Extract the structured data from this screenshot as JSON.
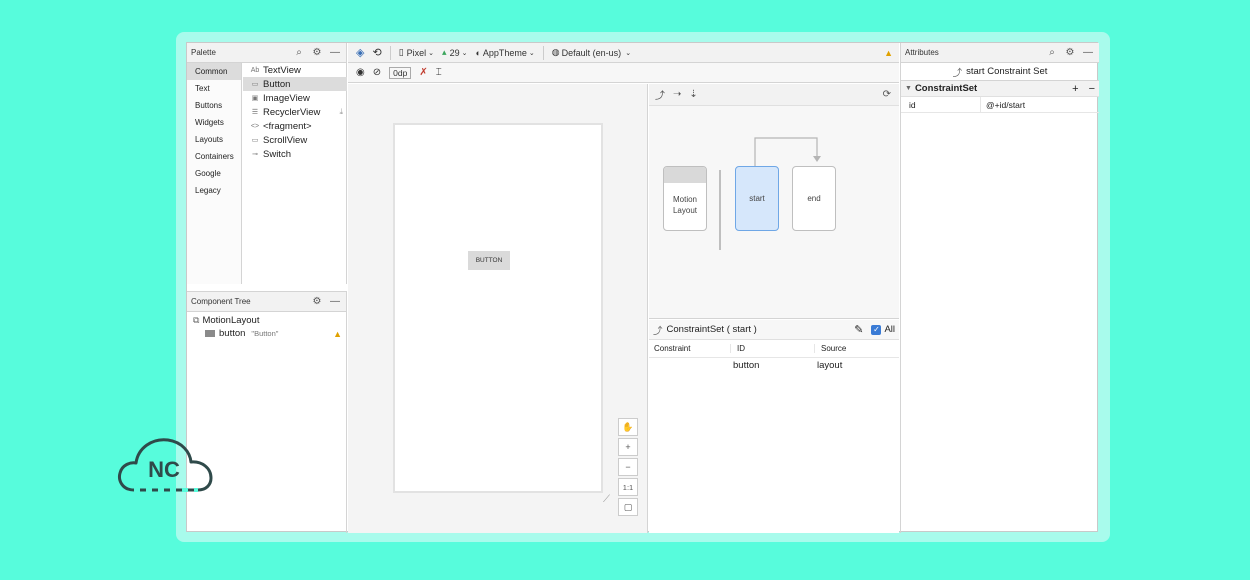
{
  "palette": {
    "title": "Palette",
    "categories": [
      "Common",
      "Text",
      "Buttons",
      "Widgets",
      "Layouts",
      "Containers",
      "Google",
      "Legacy"
    ],
    "widgets": [
      {
        "icon": "Ab",
        "label": "TextView"
      },
      {
        "icon": "▭",
        "label": "Button"
      },
      {
        "icon": "▣",
        "label": "ImageView"
      },
      {
        "icon": "☰",
        "label": "RecyclerView"
      },
      {
        "icon": "<>",
        "label": "<fragment>"
      },
      {
        "icon": "▭",
        "label": "ScrollView"
      },
      {
        "icon": "⊸",
        "label": "Switch"
      }
    ]
  },
  "tree": {
    "title": "Component Tree",
    "root": "MotionLayout",
    "child": "button",
    "child_text": "\"Button\""
  },
  "toolbar": {
    "device": "Pixel",
    "api": "29",
    "theme": "AppTheme",
    "locale": "Default (en-us)",
    "margin": "0dp"
  },
  "canvas": {
    "button_label": "BUTTON",
    "zoom_ratio": "1:1"
  },
  "motion": {
    "states": {
      "layout": "Motion Layout",
      "start": "start",
      "end": "end"
    }
  },
  "constraintset": {
    "title": "ConstraintSet ( start )",
    "all_label": "All",
    "columns": [
      "Constraint",
      "ID",
      "Source"
    ],
    "row": {
      "constraint": "",
      "id": "button",
      "source": "layout"
    }
  },
  "attributes": {
    "title": "Attributes",
    "subtitle": "start Constraint Set",
    "section": "ConstraintSet",
    "rows": [
      {
        "key": "id",
        "value": "@+id/start"
      }
    ]
  },
  "logo": {
    "text": "NC"
  }
}
